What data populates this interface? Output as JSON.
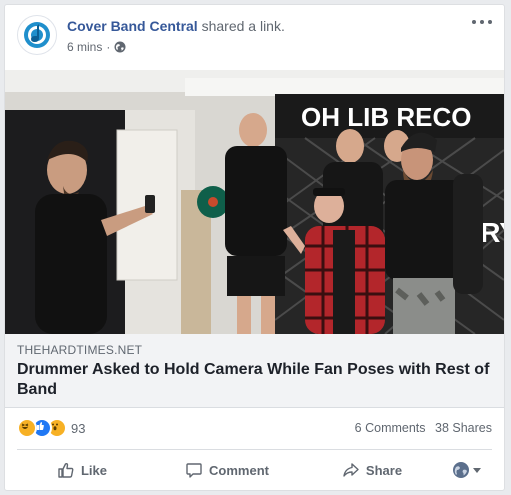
{
  "post": {
    "page_name": "Cover Band Central",
    "shared_text": "shared a link.",
    "time": "6 mins",
    "separator": "·",
    "privacy_icon": "globe-icon",
    "more_icon": "more-options-icon"
  },
  "link_preview": {
    "domain": "THEHARDTIMES.NET",
    "headline": "Drummer Asked to Hold Camera While Fan Poses with Rest of Band",
    "image_icon": "band-photo",
    "banner_text": "OH LIB   RECO",
    "banner_text_right": "NRY"
  },
  "engagement": {
    "reactions": [
      "haha-icon",
      "like-icon",
      "wow-icon"
    ],
    "reaction_count": "93",
    "comments": "6 Comments",
    "shares": "38 Shares"
  },
  "actions": {
    "like": "Like",
    "comment": "Comment",
    "share": "Share"
  },
  "colors": {
    "link_blue": "#365899",
    "like_blue": "#2078f4",
    "reaction_yellow": "#f7b125",
    "muted_text": "#606770"
  }
}
